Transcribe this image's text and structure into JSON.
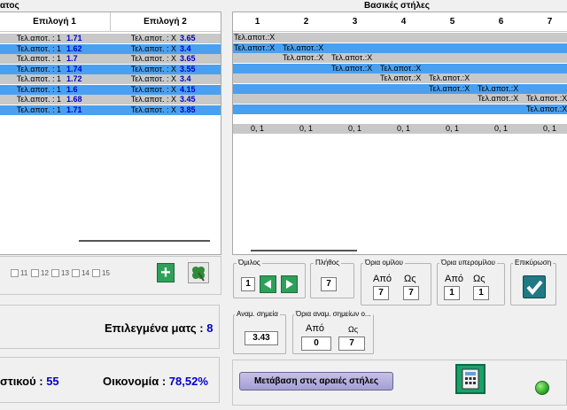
{
  "left_title": "ατος",
  "right_title": "Βασικές στήλες",
  "left_grid": {
    "headers": [
      "Επιλογή 1",
      "Επιλογή 2"
    ],
    "rows": [
      {
        "c1": "Τελ.αποτ. : 1",
        "v1": "1.71",
        "c2": "Τελ.αποτ. : X",
        "v2": "3.65",
        "style": "gray"
      },
      {
        "c1": "Τελ.αποτ. : 1",
        "v1": "1.62",
        "c2": "Τελ.αποτ. : X",
        "v2": "3.4",
        "style": "blue"
      },
      {
        "c1": "Τελ.αποτ. : 1",
        "v1": "1.7",
        "c2": "Τελ.αποτ. : X",
        "v2": "3.65",
        "style": "gray"
      },
      {
        "c1": "Τελ.αποτ. : 1",
        "v1": "1.74",
        "c2": "Τελ.αποτ. : X",
        "v2": "3.55",
        "style": "blue"
      },
      {
        "c1": "Τελ.αποτ. : 1",
        "v1": "1.72",
        "c2": "Τελ.αποτ. : X",
        "v2": "3.4",
        "style": "gray"
      },
      {
        "c1": "Τελ.αποτ. : 1",
        "v1": "1.6",
        "c2": "Τελ.αποτ. : X",
        "v2": "4.15",
        "style": "blue"
      },
      {
        "c1": "Τελ.αποτ. : 1",
        "v1": "1.68",
        "c2": "Τελ.αποτ. : X",
        "v2": "3.45",
        "style": "gray"
      },
      {
        "c1": "Τελ.αποτ. : 1",
        "v1": "1.71",
        "c2": "Τελ.αποτ. : X",
        "v2": "3.85",
        "style": "blue"
      }
    ]
  },
  "right_grid": {
    "headers": [
      "1",
      "2",
      "3",
      "4",
      "5",
      "6",
      "7"
    ],
    "cell_text": "Τελ.αποτ.:X",
    "footer": [
      "0, 1",
      "0, 1",
      "0, 1",
      "0, 1",
      "0, 1",
      "0, 1",
      "0, 1"
    ]
  },
  "checkboxes": [
    "11",
    "12",
    "13",
    "14",
    "15"
  ],
  "omilos": {
    "title": "Όμιλος",
    "value": "1"
  },
  "plithos": {
    "title": "Πλήθος",
    "value": "7"
  },
  "oria_omilou": {
    "title": "Όρια ομίλου",
    "apo_label": "Από",
    "os_label": "Ως",
    "apo": "7",
    "os": "7"
  },
  "oria_yperomilou": {
    "title": "Όρια υπερομίλου",
    "apo_label": "Από",
    "os_label": "Ως",
    "apo": "1",
    "os": "1"
  },
  "epikyrosi": {
    "title": "Επικύρωση"
  },
  "anam_simeia": {
    "title": "Αναμ. σημεία",
    "value": "3.43"
  },
  "oria_anam": {
    "title": "Όρια αναμ. σημείων ο...",
    "apo_label": "Από",
    "os_label": "Ως",
    "apo": "0",
    "os": "7"
  },
  "selected_matches": {
    "label": "Επιλεγμένα ματς :",
    "value": "8"
  },
  "systikou": {
    "label": "στικού :",
    "value": "55"
  },
  "oikonomia": {
    "label": "Οικονομία :",
    "value": "78,52%"
  },
  "goto_button": "Μετάβαση στις αραιές στήλες",
  "colors": {
    "gray_row": "#c8c8c8",
    "blue_row": "#4aa0f0",
    "value_blue": "#0000c8",
    "green_btn": "#2ea05a"
  }
}
